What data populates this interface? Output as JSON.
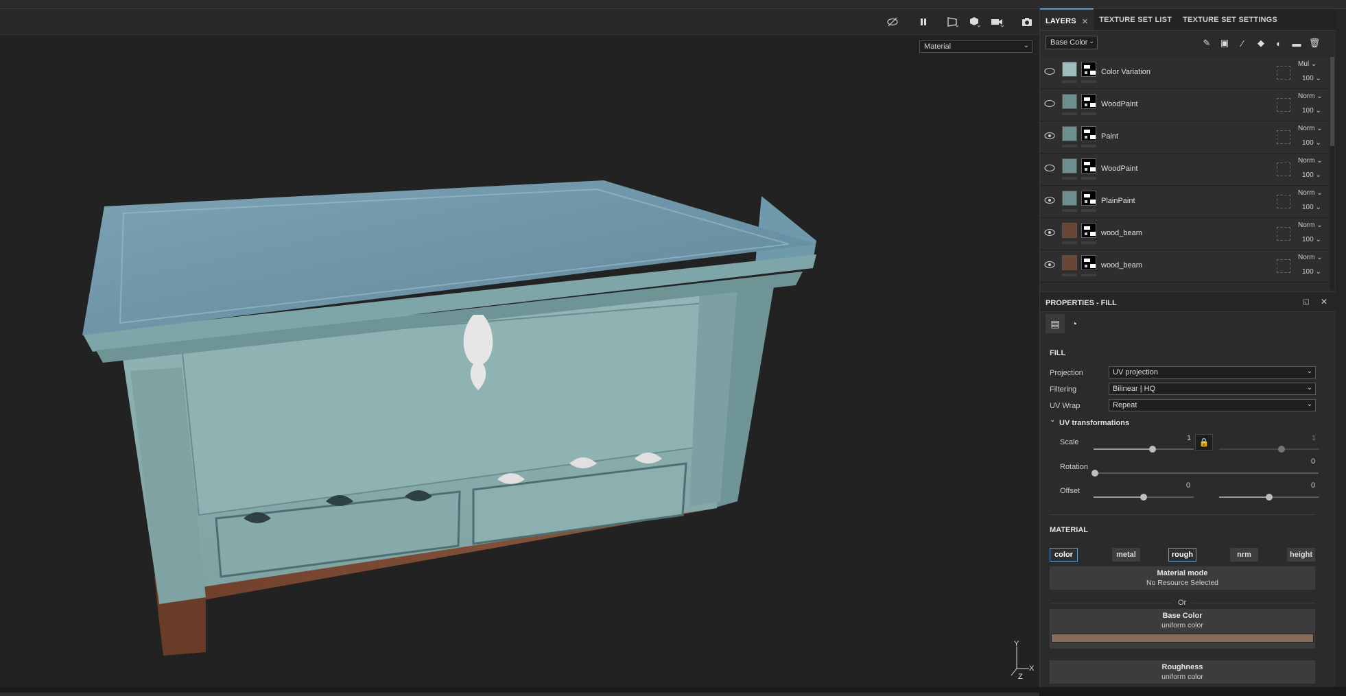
{
  "viewport": {
    "shading_select": "Material",
    "axis_labels": {
      "y": "Y",
      "x": "X",
      "z": "Z"
    },
    "toolbar_icons": [
      "hide-ui-icon",
      "pause-icon",
      "perspective-icon",
      "cube-icon",
      "camera-icon",
      "screenshot-icon"
    ]
  },
  "panel_tabs": {
    "layers": "LAYERS",
    "close": "✕",
    "texture_set_list": "TEXTURE SET LIST",
    "texture_set_settings": "TEXTURE SET SETTINGS"
  },
  "layers": {
    "channel": "Base Color",
    "items": [
      {
        "name": "Color Variation",
        "blend": "Mul",
        "opacity": "100",
        "visible": false,
        "color": "#9fbcbc"
      },
      {
        "name": "WoodPaint",
        "blend": "Norm",
        "opacity": "100",
        "visible": false,
        "color": "#6e8f8f"
      },
      {
        "name": "Paint",
        "blend": "Norm",
        "opacity": "100",
        "visible": true,
        "color": "#6e8f8f"
      },
      {
        "name": "WoodPaint",
        "blend": "Norm",
        "opacity": "100",
        "visible": false,
        "color": "#6e8f8f"
      },
      {
        "name": "PlainPaint",
        "blend": "Norm",
        "opacity": "100",
        "visible": true,
        "color": "#6e8f8f"
      },
      {
        "name": "wood_beam",
        "blend": "Norm",
        "opacity": "100",
        "visible": true,
        "color": "#6a4634"
      },
      {
        "name": "wood_beam",
        "blend": "Norm",
        "opacity": "100",
        "visible": true,
        "color": "#6a4634"
      }
    ]
  },
  "properties": {
    "title": "PROPERTIES - FILL",
    "fill_label": "FILL",
    "projection_label": "Projection",
    "projection_value": "UV projection",
    "filtering_label": "Filtering",
    "filtering_value": "Bilinear | HQ",
    "uvwrap_label": "UV Wrap",
    "uvwrap_value": "Repeat",
    "uvtrans_label": "UV transformations",
    "scale_label": "Scale",
    "scale_value": "1",
    "scale_value2": "1",
    "rotation_label": "Rotation",
    "rotation_value": "0",
    "offset_label": "Offset",
    "offset_value1": "0",
    "offset_value2": "0",
    "material_label": "MATERIAL",
    "channels": [
      "color",
      "metal",
      "rough",
      "nrm",
      "height"
    ],
    "material_mode_title": "Material mode",
    "material_mode_sub": "No Resource Selected",
    "or_label": "Or",
    "base_color_title": "Base Color",
    "base_color_sub": "uniform color",
    "base_color_swatch": "#8a6a58",
    "roughness_title": "Roughness",
    "roughness_sub": "uniform color"
  }
}
